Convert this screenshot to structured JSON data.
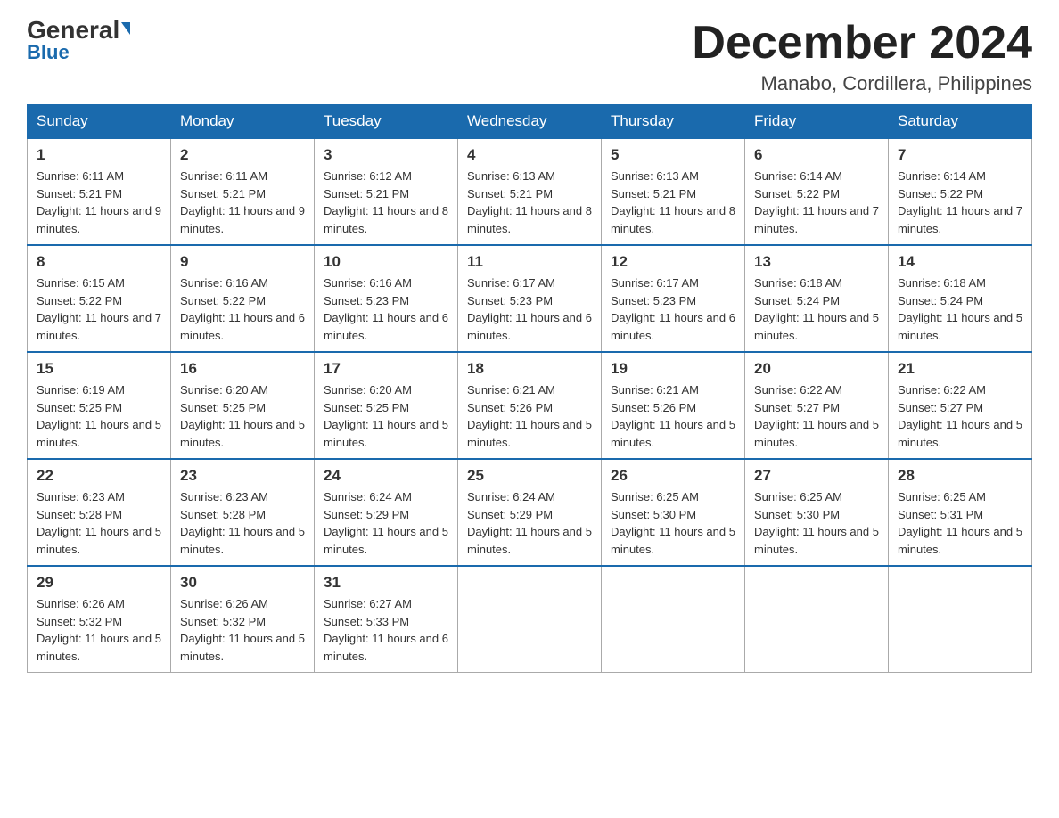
{
  "header": {
    "logo_top": "General",
    "logo_bottom": "Blue",
    "month_title": "December 2024",
    "location": "Manabo, Cordillera, Philippines"
  },
  "days_of_week": [
    "Sunday",
    "Monday",
    "Tuesday",
    "Wednesday",
    "Thursday",
    "Friday",
    "Saturday"
  ],
  "weeks": [
    [
      {
        "day": "1",
        "sunrise": "6:11 AM",
        "sunset": "5:21 PM",
        "daylight": "11 hours and 9 minutes."
      },
      {
        "day": "2",
        "sunrise": "6:11 AM",
        "sunset": "5:21 PM",
        "daylight": "11 hours and 9 minutes."
      },
      {
        "day": "3",
        "sunrise": "6:12 AM",
        "sunset": "5:21 PM",
        "daylight": "11 hours and 8 minutes."
      },
      {
        "day": "4",
        "sunrise": "6:13 AM",
        "sunset": "5:21 PM",
        "daylight": "11 hours and 8 minutes."
      },
      {
        "day": "5",
        "sunrise": "6:13 AM",
        "sunset": "5:21 PM",
        "daylight": "11 hours and 8 minutes."
      },
      {
        "day": "6",
        "sunrise": "6:14 AM",
        "sunset": "5:22 PM",
        "daylight": "11 hours and 7 minutes."
      },
      {
        "day": "7",
        "sunrise": "6:14 AM",
        "sunset": "5:22 PM",
        "daylight": "11 hours and 7 minutes."
      }
    ],
    [
      {
        "day": "8",
        "sunrise": "6:15 AM",
        "sunset": "5:22 PM",
        "daylight": "11 hours and 7 minutes."
      },
      {
        "day": "9",
        "sunrise": "6:16 AM",
        "sunset": "5:22 PM",
        "daylight": "11 hours and 6 minutes."
      },
      {
        "day": "10",
        "sunrise": "6:16 AM",
        "sunset": "5:23 PM",
        "daylight": "11 hours and 6 minutes."
      },
      {
        "day": "11",
        "sunrise": "6:17 AM",
        "sunset": "5:23 PM",
        "daylight": "11 hours and 6 minutes."
      },
      {
        "day": "12",
        "sunrise": "6:17 AM",
        "sunset": "5:23 PM",
        "daylight": "11 hours and 6 minutes."
      },
      {
        "day": "13",
        "sunrise": "6:18 AM",
        "sunset": "5:24 PM",
        "daylight": "11 hours and 5 minutes."
      },
      {
        "day": "14",
        "sunrise": "6:18 AM",
        "sunset": "5:24 PM",
        "daylight": "11 hours and 5 minutes."
      }
    ],
    [
      {
        "day": "15",
        "sunrise": "6:19 AM",
        "sunset": "5:25 PM",
        "daylight": "11 hours and 5 minutes."
      },
      {
        "day": "16",
        "sunrise": "6:20 AM",
        "sunset": "5:25 PM",
        "daylight": "11 hours and 5 minutes."
      },
      {
        "day": "17",
        "sunrise": "6:20 AM",
        "sunset": "5:25 PM",
        "daylight": "11 hours and 5 minutes."
      },
      {
        "day": "18",
        "sunrise": "6:21 AM",
        "sunset": "5:26 PM",
        "daylight": "11 hours and 5 minutes."
      },
      {
        "day": "19",
        "sunrise": "6:21 AM",
        "sunset": "5:26 PM",
        "daylight": "11 hours and 5 minutes."
      },
      {
        "day": "20",
        "sunrise": "6:22 AM",
        "sunset": "5:27 PM",
        "daylight": "11 hours and 5 minutes."
      },
      {
        "day": "21",
        "sunrise": "6:22 AM",
        "sunset": "5:27 PM",
        "daylight": "11 hours and 5 minutes."
      }
    ],
    [
      {
        "day": "22",
        "sunrise": "6:23 AM",
        "sunset": "5:28 PM",
        "daylight": "11 hours and 5 minutes."
      },
      {
        "day": "23",
        "sunrise": "6:23 AM",
        "sunset": "5:28 PM",
        "daylight": "11 hours and 5 minutes."
      },
      {
        "day": "24",
        "sunrise": "6:24 AM",
        "sunset": "5:29 PM",
        "daylight": "11 hours and 5 minutes."
      },
      {
        "day": "25",
        "sunrise": "6:24 AM",
        "sunset": "5:29 PM",
        "daylight": "11 hours and 5 minutes."
      },
      {
        "day": "26",
        "sunrise": "6:25 AM",
        "sunset": "5:30 PM",
        "daylight": "11 hours and 5 minutes."
      },
      {
        "day": "27",
        "sunrise": "6:25 AM",
        "sunset": "5:30 PM",
        "daylight": "11 hours and 5 minutes."
      },
      {
        "day": "28",
        "sunrise": "6:25 AM",
        "sunset": "5:31 PM",
        "daylight": "11 hours and 5 minutes."
      }
    ],
    [
      {
        "day": "29",
        "sunrise": "6:26 AM",
        "sunset": "5:32 PM",
        "daylight": "11 hours and 5 minutes."
      },
      {
        "day": "30",
        "sunrise": "6:26 AM",
        "sunset": "5:32 PM",
        "daylight": "11 hours and 5 minutes."
      },
      {
        "day": "31",
        "sunrise": "6:27 AM",
        "sunset": "5:33 PM",
        "daylight": "11 hours and 6 minutes."
      },
      null,
      null,
      null,
      null
    ]
  ],
  "labels": {
    "sunrise_prefix": "Sunrise: ",
    "sunset_prefix": "Sunset: ",
    "daylight_prefix": "Daylight: "
  }
}
